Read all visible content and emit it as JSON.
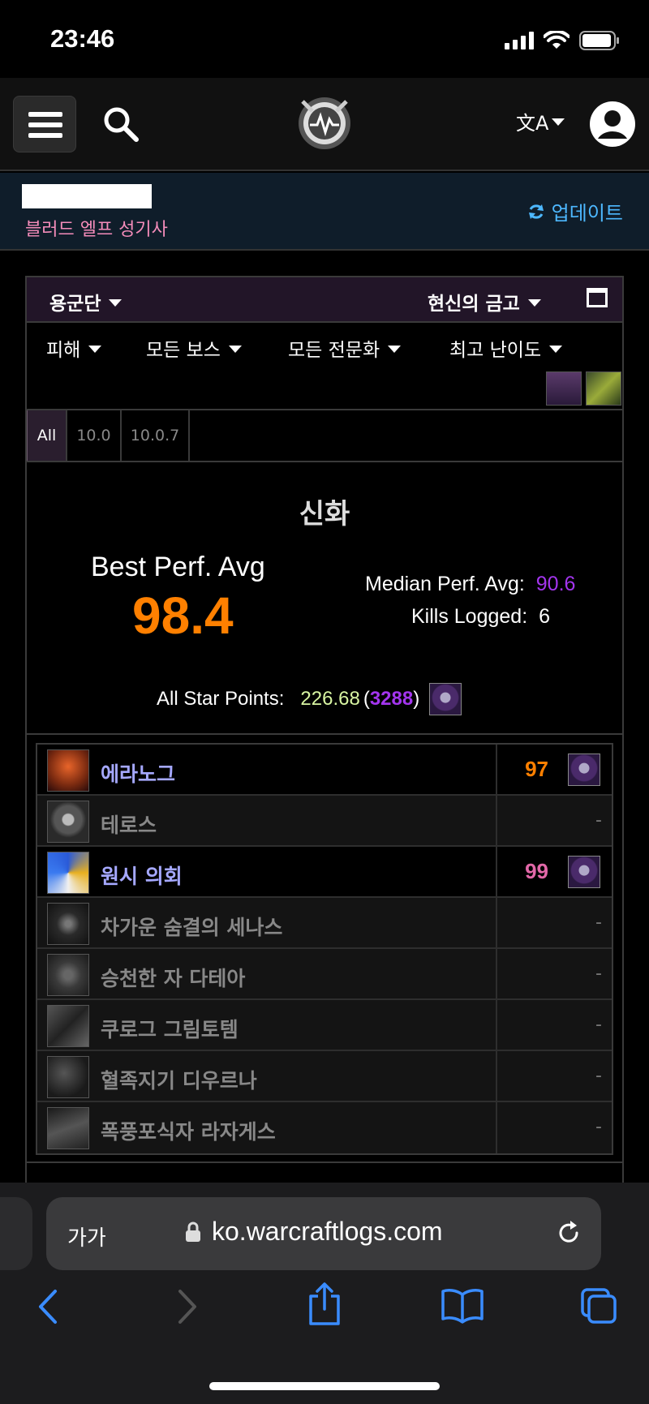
{
  "status_bar": {
    "time": "23:46"
  },
  "navbar": {
    "menu_icon": "hamburger-menu-icon",
    "search_icon": "search-icon",
    "logo_icon": "warcraftlogs-logo-icon",
    "language_icon": "translate-icon",
    "user_icon": "user-account-icon"
  },
  "character": {
    "class_label": "블러드 엘프 성기사",
    "update_label": "업데이트"
  },
  "filters": {
    "zone": "용군단",
    "raid": "현신의 금고",
    "metric": "피해",
    "boss": "모든 보스",
    "spec": "모든 전문화",
    "difficulty_mode": "최고 난이도"
  },
  "tabs": [
    "All",
    "10.0",
    "10.0.7"
  ],
  "summary": {
    "difficulty": "신화",
    "best_label": "Best Perf. Avg",
    "best_value": "98.4",
    "median_label": "Median Perf. Avg:",
    "median_value": "90.6",
    "kills_label": "Kills Logged:",
    "kills_value": "6",
    "stars_label": "All Star Points:",
    "stars_value": "226.68",
    "stars_rank": "3288",
    "paren_open": "(",
    "paren_close": ")"
  },
  "bosses": [
    {
      "name": "에라노그",
      "score": "97",
      "score_color": "#ff8000"
    },
    {
      "name": "테로스",
      "dash": "-"
    },
    {
      "name": "원시 의회",
      "score": "99",
      "score_color": "#e268a8"
    },
    {
      "name": "차가운 숨결의 세나스",
      "dash": "-"
    },
    {
      "name": "승천한 자 다테아",
      "dash": "-"
    },
    {
      "name": "쿠로그 그림토템",
      "dash": "-"
    },
    {
      "name": "혈족지기 디우르나",
      "dash": "-"
    },
    {
      "name": "폭풍포식자 라자게스",
      "dash": "-"
    }
  ],
  "browser": {
    "text_size_label": "가가",
    "url": "ko.warcraftlogs.com"
  },
  "colors": {
    "accent_orange": "#ff8000",
    "accent_purple": "#a335ee",
    "accent_pink": "#e268a8",
    "link_blue": "#4db8ff",
    "class_color": "#f48cba"
  }
}
